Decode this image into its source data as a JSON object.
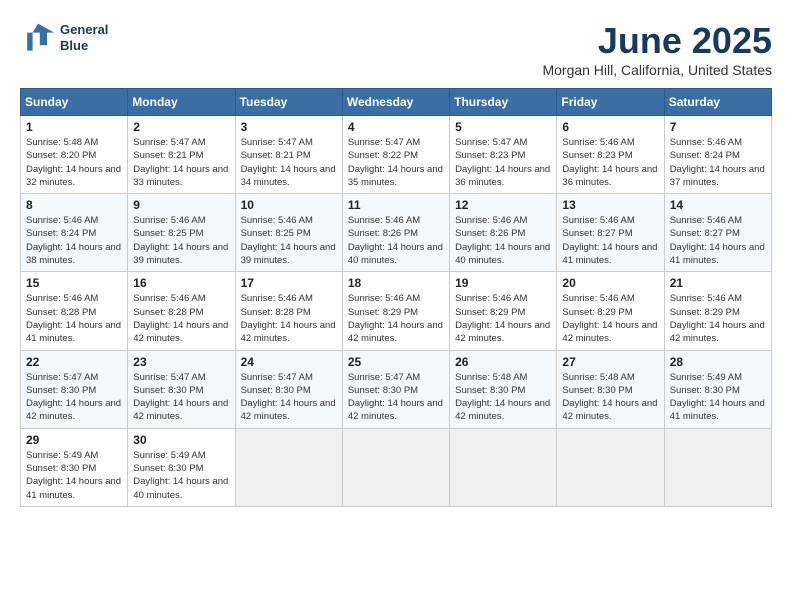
{
  "logo": {
    "line1": "General",
    "line2": "Blue"
  },
  "title": "June 2025",
  "subtitle": "Morgan Hill, California, United States",
  "headers": [
    "Sunday",
    "Monday",
    "Tuesday",
    "Wednesday",
    "Thursday",
    "Friday",
    "Saturday"
  ],
  "weeks": [
    [
      {
        "day": "1",
        "sunrise": "5:48 AM",
        "sunset": "8:20 PM",
        "daylight": "14 hours and 32 minutes."
      },
      {
        "day": "2",
        "sunrise": "5:47 AM",
        "sunset": "8:21 PM",
        "daylight": "14 hours and 33 minutes."
      },
      {
        "day": "3",
        "sunrise": "5:47 AM",
        "sunset": "8:21 PM",
        "daylight": "14 hours and 34 minutes."
      },
      {
        "day": "4",
        "sunrise": "5:47 AM",
        "sunset": "8:22 PM",
        "daylight": "14 hours and 35 minutes."
      },
      {
        "day": "5",
        "sunrise": "5:47 AM",
        "sunset": "8:23 PM",
        "daylight": "14 hours and 36 minutes."
      },
      {
        "day": "6",
        "sunrise": "5:46 AM",
        "sunset": "8:23 PM",
        "daylight": "14 hours and 36 minutes."
      },
      {
        "day": "7",
        "sunrise": "5:46 AM",
        "sunset": "8:24 PM",
        "daylight": "14 hours and 37 minutes."
      }
    ],
    [
      {
        "day": "8",
        "sunrise": "5:46 AM",
        "sunset": "8:24 PM",
        "daylight": "14 hours and 38 minutes."
      },
      {
        "day": "9",
        "sunrise": "5:46 AM",
        "sunset": "8:25 PM",
        "daylight": "14 hours and 39 minutes."
      },
      {
        "day": "10",
        "sunrise": "5:46 AM",
        "sunset": "8:25 PM",
        "daylight": "14 hours and 39 minutes."
      },
      {
        "day": "11",
        "sunrise": "5:46 AM",
        "sunset": "8:26 PM",
        "daylight": "14 hours and 40 minutes."
      },
      {
        "day": "12",
        "sunrise": "5:46 AM",
        "sunset": "8:26 PM",
        "daylight": "14 hours and 40 minutes."
      },
      {
        "day": "13",
        "sunrise": "5:46 AM",
        "sunset": "8:27 PM",
        "daylight": "14 hours and 41 minutes."
      },
      {
        "day": "14",
        "sunrise": "5:46 AM",
        "sunset": "8:27 PM",
        "daylight": "14 hours and 41 minutes."
      }
    ],
    [
      {
        "day": "15",
        "sunrise": "5:46 AM",
        "sunset": "8:28 PM",
        "daylight": "14 hours and 41 minutes."
      },
      {
        "day": "16",
        "sunrise": "5:46 AM",
        "sunset": "8:28 PM",
        "daylight": "14 hours and 42 minutes."
      },
      {
        "day": "17",
        "sunrise": "5:46 AM",
        "sunset": "8:28 PM",
        "daylight": "14 hours and 42 minutes."
      },
      {
        "day": "18",
        "sunrise": "5:46 AM",
        "sunset": "8:29 PM",
        "daylight": "14 hours and 42 minutes."
      },
      {
        "day": "19",
        "sunrise": "5:46 AM",
        "sunset": "8:29 PM",
        "daylight": "14 hours and 42 minutes."
      },
      {
        "day": "20",
        "sunrise": "5:46 AM",
        "sunset": "8:29 PM",
        "daylight": "14 hours and 42 minutes."
      },
      {
        "day": "21",
        "sunrise": "5:46 AM",
        "sunset": "8:29 PM",
        "daylight": "14 hours and 42 minutes."
      }
    ],
    [
      {
        "day": "22",
        "sunrise": "5:47 AM",
        "sunset": "8:30 PM",
        "daylight": "14 hours and 42 minutes."
      },
      {
        "day": "23",
        "sunrise": "5:47 AM",
        "sunset": "8:30 PM",
        "daylight": "14 hours and 42 minutes."
      },
      {
        "day": "24",
        "sunrise": "5:47 AM",
        "sunset": "8:30 PM",
        "daylight": "14 hours and 42 minutes."
      },
      {
        "day": "25",
        "sunrise": "5:47 AM",
        "sunset": "8:30 PM",
        "daylight": "14 hours and 42 minutes."
      },
      {
        "day": "26",
        "sunrise": "5:48 AM",
        "sunset": "8:30 PM",
        "daylight": "14 hours and 42 minutes."
      },
      {
        "day": "27",
        "sunrise": "5:48 AM",
        "sunset": "8:30 PM",
        "daylight": "14 hours and 42 minutes."
      },
      {
        "day": "28",
        "sunrise": "5:49 AM",
        "sunset": "8:30 PM",
        "daylight": "14 hours and 41 minutes."
      }
    ],
    [
      {
        "day": "29",
        "sunrise": "5:49 AM",
        "sunset": "8:30 PM",
        "daylight": "14 hours and 41 minutes."
      },
      {
        "day": "30",
        "sunrise": "5:49 AM",
        "sunset": "8:30 PM",
        "daylight": "14 hours and 40 minutes."
      },
      null,
      null,
      null,
      null,
      null
    ]
  ]
}
